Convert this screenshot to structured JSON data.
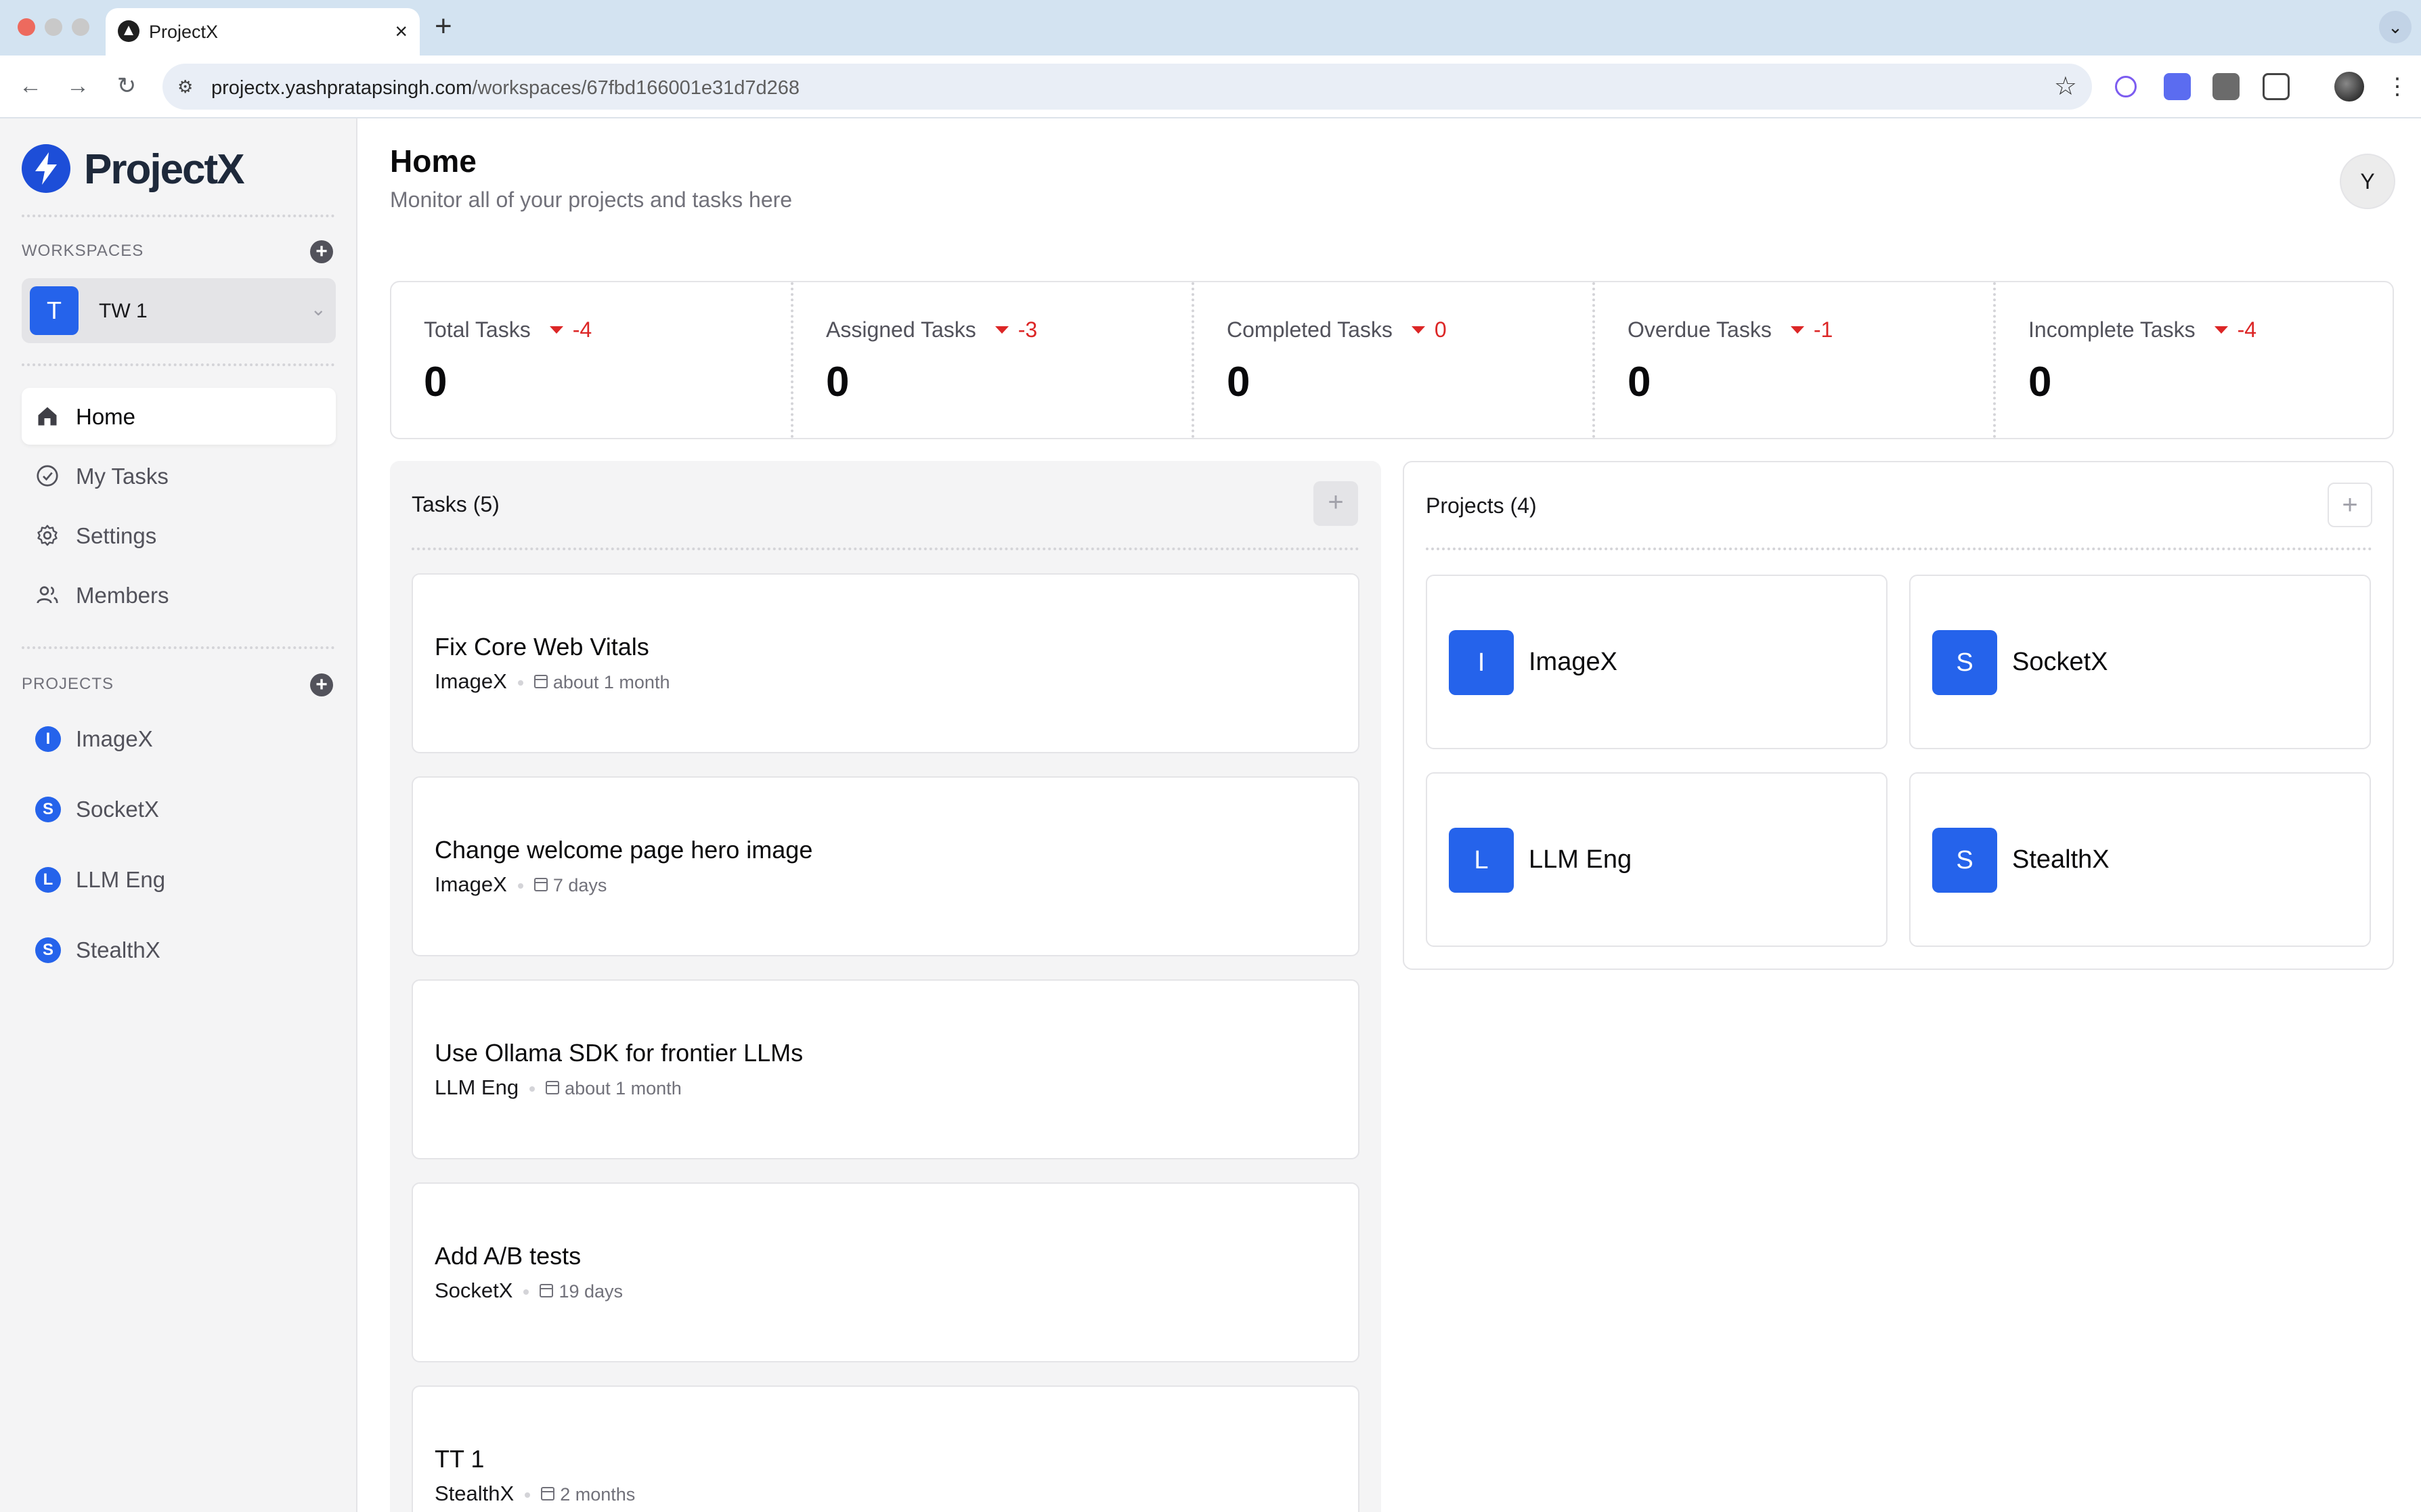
{
  "browser": {
    "tab_title": "ProjectX",
    "tab_close": "×",
    "new_tab": "+",
    "tab_menu": "⌄",
    "url_host": "projectx.yashpratapsingh.com",
    "url_path": "/workspaces/67fbd166001e31d7d268",
    "back": "←",
    "forward": "→",
    "reload": "↻",
    "star": "☆",
    "menu": "⋮",
    "site_info": "⚙",
    "traffic_colors": [
      "#ed6a5e",
      "#c9c9c9",
      "#c9c9c9"
    ]
  },
  "app": {
    "name": "ProjectX",
    "accent": "#2563eb",
    "logo_color": "#1d4ed8"
  },
  "sidebar": {
    "workspaces_label": "WORKSPACES",
    "workspace": {
      "initial": "T",
      "name": "TW 1",
      "chevron": "⌄"
    },
    "nav": [
      {
        "label": "Home",
        "icon": "home-icon",
        "active": true
      },
      {
        "label": "My Tasks",
        "icon": "check-circle-icon",
        "active": false
      },
      {
        "label": "Settings",
        "icon": "gear-icon",
        "active": false
      },
      {
        "label": "Members",
        "icon": "users-icon",
        "active": false
      }
    ],
    "projects_label": "PROJECTS",
    "projects": [
      {
        "initial": "I",
        "name": "ImageX"
      },
      {
        "initial": "S",
        "name": "SocketX"
      },
      {
        "initial": "L",
        "name": "LLM Eng"
      },
      {
        "initial": "S",
        "name": "StealthX"
      }
    ],
    "add": "+"
  },
  "header": {
    "title": "Home",
    "subtitle": "Monitor all of your projects and tasks here",
    "user_initial": "Y"
  },
  "stats": [
    {
      "label": "Total Tasks",
      "delta": "-4",
      "value": "0"
    },
    {
      "label": "Assigned Tasks",
      "delta": "-3",
      "value": "0"
    },
    {
      "label": "Completed Tasks",
      "delta": "0",
      "value": "0"
    },
    {
      "label": "Overdue Tasks",
      "delta": "-1",
      "value": "0"
    },
    {
      "label": "Incomplete Tasks",
      "delta": "-4",
      "value": "0"
    }
  ],
  "tasks_panel": {
    "title": "Tasks (5)",
    "add": "+",
    "items": [
      {
        "name": "Fix Core Web Vitals",
        "project": "ImageX",
        "due": "about 1 month"
      },
      {
        "name": "Change welcome page hero image",
        "project": "ImageX",
        "due": "7 days"
      },
      {
        "name": "Use Ollama SDK for frontier LLMs",
        "project": "LLM Eng",
        "due": "about 1 month"
      },
      {
        "name": "Add A/B tests",
        "project": "SocketX",
        "due": "19 days"
      },
      {
        "name": "TT 1",
        "project": "StealthX",
        "due": "2 months"
      }
    ]
  },
  "projects_panel": {
    "title": "Projects (4)",
    "add": "+",
    "items": [
      {
        "initial": "I",
        "name": "ImageX"
      },
      {
        "initial": "S",
        "name": "SocketX"
      },
      {
        "initial": "L",
        "name": "LLM Eng"
      },
      {
        "initial": "S",
        "name": "StealthX"
      }
    ]
  }
}
